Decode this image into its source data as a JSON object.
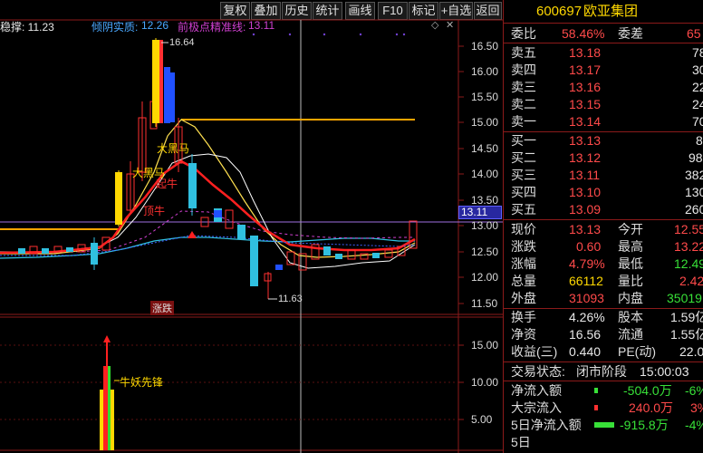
{
  "toolbar": {
    "buttons": [
      "复权",
      "叠加",
      "历史",
      "统计",
      "画线",
      "F10",
      "标记",
      "+自选",
      "返回"
    ]
  },
  "chart_header": {
    "left_text": "稳撑: 11.23",
    "bull_label": "倾阴实质:",
    "bull_value": "12.26",
    "line_label": "前极点精准线:",
    "line_value": "13.11"
  },
  "price_axis": [
    "16.50",
    "16.00",
    "15.50",
    "15.00",
    "14.50",
    "14.00",
    "13.50",
    "13.00",
    "12.50",
    "12.00",
    "11.50"
  ],
  "current_price_tag": "13.11",
  "annotations": {
    "high": "16.64",
    "low": "11.63",
    "dahei1": "大黑马",
    "dahei2": "大黑马",
    "yuniu": "起牛",
    "dingniu": "顶牛",
    "zhangdie": "涨跌"
  },
  "sub_axis": [
    "15.00",
    "10.00",
    "5.00"
  ],
  "sub_annotation": "牛妖先锋",
  "panel": {
    "code": "600697",
    "name": "欧亚集团",
    "weibi_label": "委比",
    "weibi_value": "58.46%",
    "weicha_label": "委差",
    "weicha_value": "65",
    "asks": [
      {
        "label": "卖五",
        "price": "13.18",
        "vol": "78"
      },
      {
        "label": "卖四",
        "price": "13.17",
        "vol": "30"
      },
      {
        "label": "卖三",
        "price": "13.16",
        "vol": "22"
      },
      {
        "label": "卖二",
        "price": "13.15",
        "vol": "24"
      },
      {
        "label": "卖一",
        "price": "13.14",
        "vol": "70"
      }
    ],
    "bids": [
      {
        "label": "买一",
        "price": "13.13",
        "vol": "8"
      },
      {
        "label": "买二",
        "price": "13.12",
        "vol": "98"
      },
      {
        "label": "买三",
        "price": "13.11",
        "vol": "382"
      },
      {
        "label": "买四",
        "price": "13.10",
        "vol": "130"
      },
      {
        "label": "买五",
        "price": "13.09",
        "vol": "260"
      }
    ],
    "stats": [
      {
        "l1": "现价",
        "v1": "13.13",
        "l2": "今开",
        "v2": "12.55"
      },
      {
        "l1": "涨跌",
        "v1": "0.60",
        "l2": "最高",
        "v2": "13.22"
      },
      {
        "l1": "涨幅",
        "v1": "4.79%",
        "l2": "最低",
        "v2": "12.49"
      },
      {
        "l1": "总量",
        "v1": "66112",
        "l2": "量比",
        "v2": "2.42"
      },
      {
        "l1": "外盘",
        "v1": "31093",
        "l2": "内盘",
        "v2": "35019"
      }
    ],
    "stats2": [
      {
        "l1": "换手",
        "v1": "4.26%",
        "l2": "股本",
        "v2": "1.59亿"
      },
      {
        "l1": "净资",
        "v1": "16.56",
        "l2": "流通",
        "v2": "1.55亿"
      },
      {
        "l1": "收益(三)",
        "v1": "0.440",
        "l2": "PE(动)",
        "v2": "22.0"
      }
    ],
    "trade_status_label": "交易状态:",
    "trade_status_value": "闭市阶段",
    "trade_time": "15:00:03",
    "flows": [
      {
        "label": "净流入额",
        "value": "-504.0万",
        "pct": "-6%"
      },
      {
        "label": "大宗流入",
        "value": "240.0万",
        "pct": "3%"
      },
      {
        "label": "5日净流入额",
        "value": "-915.8万",
        "pct": "-4%"
      },
      {
        "label": "5日",
        "value": "",
        "pct": ""
      }
    ]
  }
}
